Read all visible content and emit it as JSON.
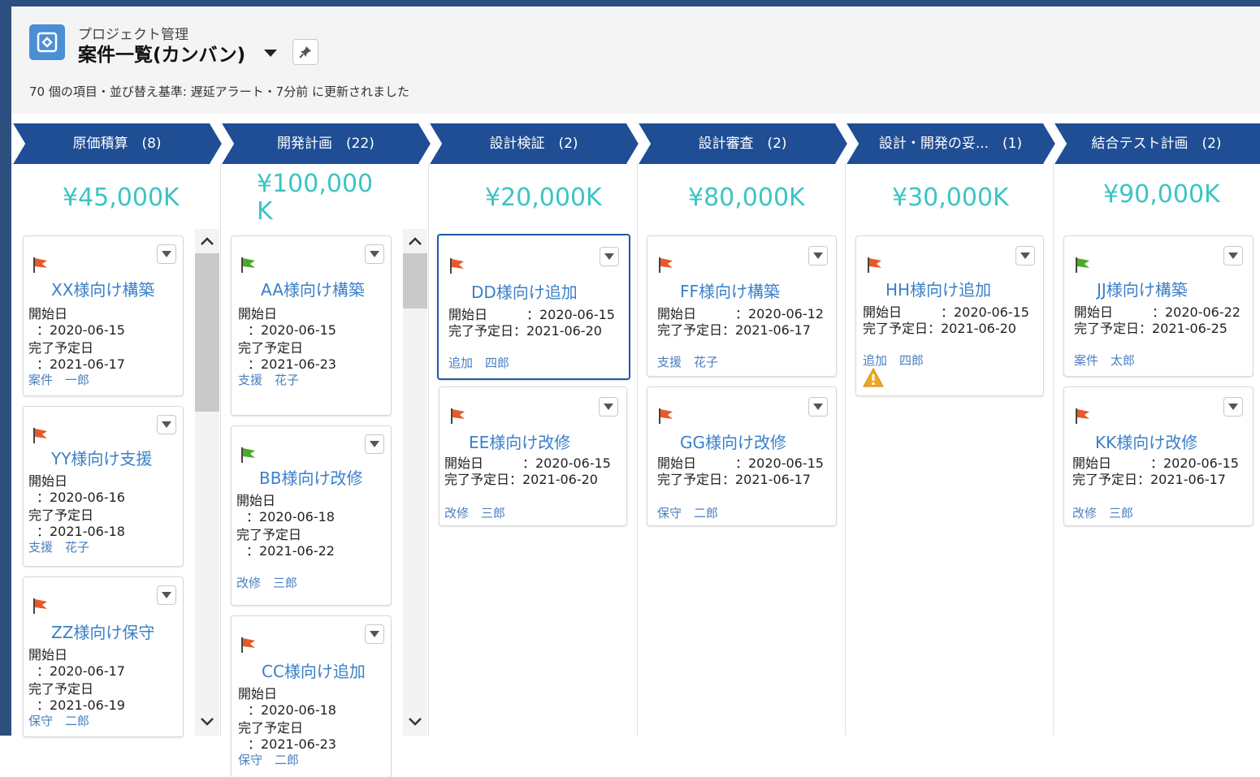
{
  "header": {
    "app_label": "プロジェクト管理",
    "view_title": "案件一覧(カンバン)",
    "status": "70 個の項目・並び替え基準: 遅延アラート・7分前 に更新されました"
  },
  "colors": {
    "header_band": "#2d4f7f",
    "stage": "#1f4e95",
    "total": "#3cc4c4",
    "link": "#3a7fc8",
    "flag_red": "#e8592a",
    "flag_green": "#4caa2a",
    "selected_border": "#1e5aa8"
  },
  "columns": [
    {
      "stage": "原価積算　(8)",
      "total": "¥45,000K",
      "cards": [
        {
          "title": "XX様向け構築",
          "start_label": "開始日",
          "start": "：2020-06-15",
          "end_label": "完了予定日",
          "end": "：2021-06-17",
          "owner": "案件　一郎",
          "flag": "red"
        },
        {
          "title": "YY様向け支援",
          "start_label": "開始日",
          "start": "：2020-06-16",
          "end_label": "完了予定日",
          "end": "：2021-06-18",
          "owner": "支援　花子",
          "flag": "red"
        },
        {
          "title": "ZZ様向け保守",
          "start_label": "開始日",
          "start": "：2020-06-17",
          "end_label": "完了予定日",
          "end": "：2021-06-19",
          "owner": "保守　二郎",
          "flag": "red"
        }
      ]
    },
    {
      "stage": "開発計画　(22)",
      "total_line1": "¥100,000",
      "total_line2": "K",
      "cards": [
        {
          "title": "AA様向け構築",
          "start_label": "開始日",
          "start": "：2020-06-15",
          "end_label": "完了予定日",
          "end": "：2021-06-23",
          "owner": "支援　花子",
          "flag": "green"
        },
        {
          "title": "BB様向け改修",
          "start_label": "開始日",
          "start": "：2020-06-18",
          "end_label": "完了予定日",
          "end": "：2021-06-22",
          "owner": "改修　三郎",
          "flag": "green"
        },
        {
          "title": "CC様向け追加",
          "start_label": "開始日",
          "start": "：2020-06-18",
          "end_label": "完了予定日",
          "end": "：2021-06-23",
          "owner": "保守　二郎",
          "flag": "red"
        }
      ]
    },
    {
      "stage": "設計検証　(2)",
      "total": "¥20,000K",
      "cards": [
        {
          "title": "DD様向け追加",
          "start_line": "開始日　　　：2020-06-15",
          "end_line": "完了予定日：2021-06-20",
          "owner": "追加　四郎",
          "flag": "red"
        },
        {
          "title": "EE様向け改修",
          "start_line": "開始日　　　：2020-06-15",
          "end_line": "完了予定日：2021-06-20",
          "owner": "改修　三郎",
          "flag": "red"
        }
      ]
    },
    {
      "stage": "設計審査　(2)",
      "total": "¥80,000K",
      "cards": [
        {
          "title": "FF様向け構築",
          "start_line": "開始日　　　：2020-06-12",
          "end_line": "完了予定日：2021-06-17",
          "owner": "支援　花子",
          "flag": "red"
        },
        {
          "title": "GG様向け改修",
          "start_line": "開始日　　　：2020-06-15",
          "end_line": "完了予定日：2021-06-17",
          "owner": "保守　二郎",
          "flag": "red"
        }
      ]
    },
    {
      "stage": "設計・開発の妥...　(1)",
      "total": "¥30,000K",
      "cards": [
        {
          "title": "HH様向け追加",
          "start_line": "開始日　　　：2020-06-15",
          "end_line": "完了予定日：2021-06-20",
          "owner": "追加　四郎",
          "flag": "red",
          "warning": "warning-icon"
        }
      ]
    },
    {
      "stage": "結合テスト計画　(2)",
      "total": "¥90,000K",
      "cards": [
        {
          "title": "JJ様向け構築",
          "start_line": "開始日　　　：2020-06-22",
          "end_line": "完了予定日：2021-06-25",
          "owner": "案件　太郎",
          "flag": "green"
        },
        {
          "title": "KK様向け改修",
          "start_line": "開始日　　　：2020-06-15",
          "end_line": "完了予定日：2021-06-17",
          "owner": "改修　三郎",
          "flag": "red"
        }
      ]
    }
  ]
}
